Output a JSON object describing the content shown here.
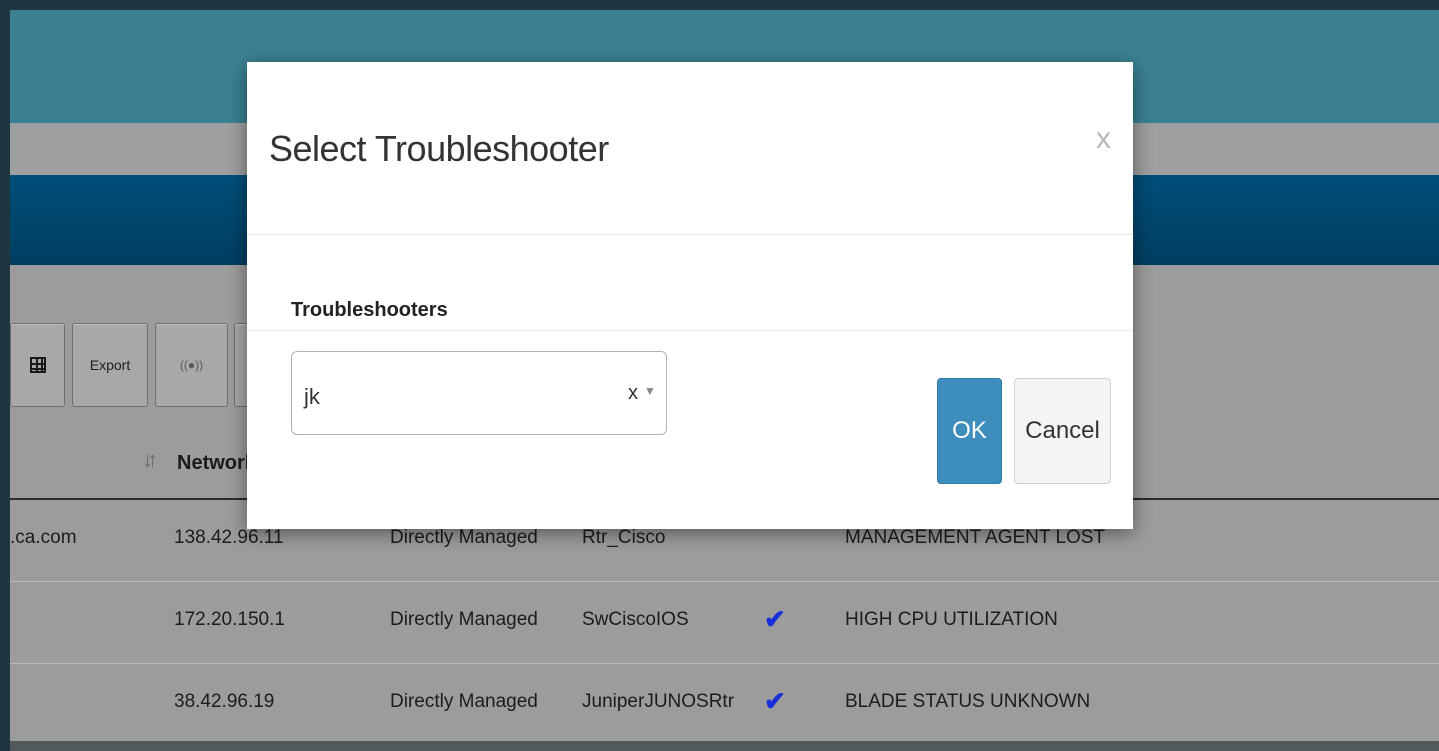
{
  "toolbar": {
    "export_label": "Export",
    "signal_label": "((●))"
  },
  "table": {
    "columns": {
      "network_address": "Network"
    },
    "rows": [
      {
        "host": ".ca.com",
        "ip": "138.42.96.11",
        "management": "Directly Managed",
        "type": "Rtr_Cisco",
        "check": "",
        "alarm": "MANAGEMENT AGENT LOST"
      },
      {
        "host": "",
        "ip": "172.20.150.1",
        "management": "Directly Managed",
        "type": "SwCiscoIOS",
        "check": "✔",
        "alarm": "HIGH CPU UTILIZATION"
      },
      {
        "host": "",
        "ip": "38.42.96.19",
        "management": "Directly Managed",
        "type": "JuniperJUNOSRtr",
        "check": "✔",
        "alarm": "BLADE STATUS UNKNOWN"
      }
    ]
  },
  "modal": {
    "title": "Select Troubleshooter",
    "close_glyph": "x",
    "field_label": "Troubleshooters",
    "select_value": "jk",
    "clear_glyph": "x",
    "caret_glyph": "▼",
    "ok_label": "OK",
    "cancel_label": "Cancel"
  },
  "icons": {
    "grid": "grid-icon",
    "sort": "sort-icon",
    "check": "check-icon",
    "close": "close-icon"
  },
  "colors": {
    "header_teal": "#3b8193",
    "band_blue": "#004f7a",
    "ok_button": "#3d8dbd",
    "check_blue": "#1530d8"
  }
}
